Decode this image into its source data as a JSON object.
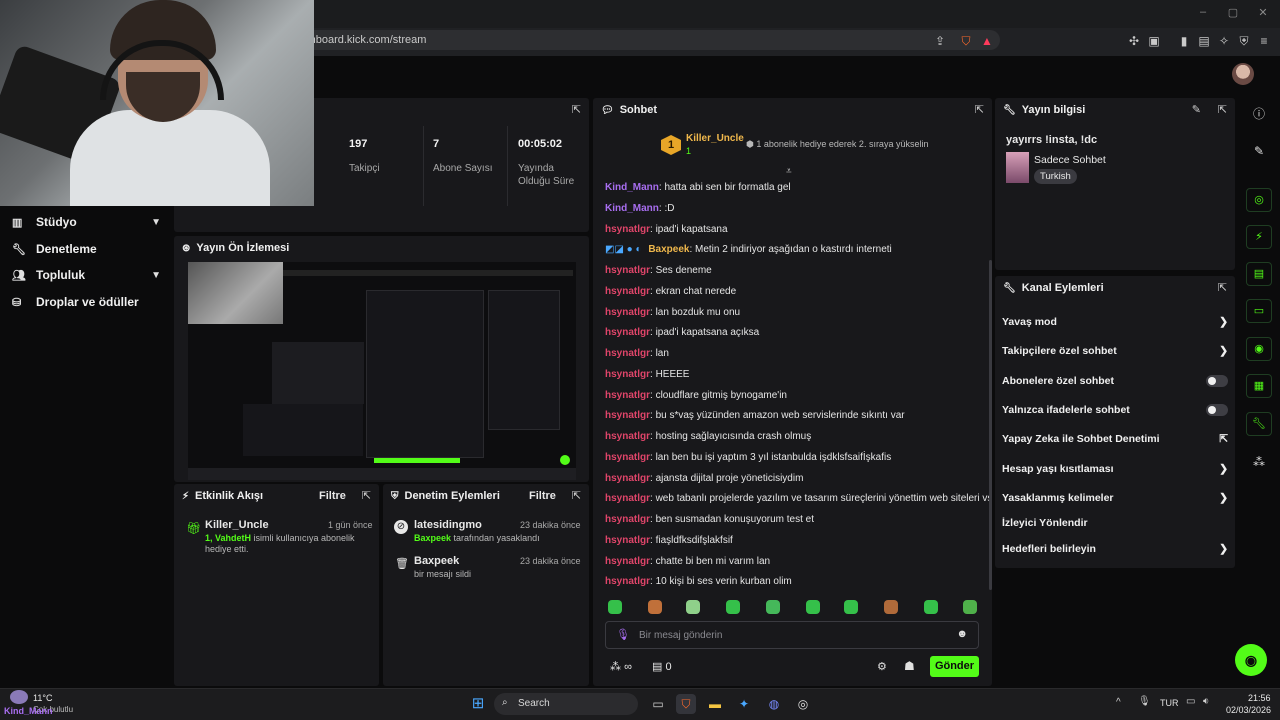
{
  "browser": {
    "url": "ashboard.kick.com/stream"
  },
  "sidebar": {
    "items": [
      {
        "label": "Stüdyo",
        "icon": "studio-icon",
        "expandable": true
      },
      {
        "label": "Denetleme",
        "icon": "wrench-icon",
        "expandable": false
      },
      {
        "label": "Topluluk",
        "icon": "community-icon",
        "expandable": true
      },
      {
        "label": "Droplar ve ödüller",
        "icon": "drops-icon",
        "expandable": false
      }
    ]
  },
  "stats": {
    "followers": {
      "value": "197",
      "label": "Takipçi"
    },
    "subs": {
      "value": "7",
      "label": "Abone Sayısı"
    },
    "uptime": {
      "value": "00:05:02",
      "label_line1": "Yayında",
      "label_line2": "Olduğu Süre"
    }
  },
  "preview": {
    "title": "Yayın Ön İzlemesi"
  },
  "activity": {
    "title": "Etkinlik Akışı",
    "filter": "Filtre",
    "items": [
      {
        "user": "Killer_Uncle",
        "time": "1 gün önce",
        "prefix": "1, VahdetH",
        "text": " isimli kullanıcıya abonelik hediye etti."
      }
    ]
  },
  "moderation": {
    "title": "Denetim Eylemleri",
    "filter": "Filtre",
    "items": [
      {
        "user": "latesidingmo",
        "time": "23 dakika önce",
        "actor": "Baxpeek",
        "text": " tarafından yasaklandı"
      },
      {
        "user": "Baxpeek",
        "time": "23 dakika önce",
        "actor": "",
        "text": "bir mesajı sildi"
      }
    ]
  },
  "chat": {
    "title": "Sohbet",
    "pinned": {
      "user": "Killer_Uncle",
      "rank": "1",
      "count": "1",
      "note": "1 abonelik hediye ederek 2. sıraya yükselin"
    },
    "messages": [
      {
        "user": "Kind_Mann",
        "color": "purple",
        "text": ": hatta abi sen bir formatla gel"
      },
      {
        "user": "Kind_Mann",
        "color": "purple",
        "text": ": :D"
      },
      {
        "user": "hsynatlgr",
        "color": "pink",
        "text": ": ipad'i kapatsana"
      },
      {
        "user": "Baxpeek",
        "color": "gold",
        "text": ": Metin 2 indiriyor aşağıdan o kastırdı interneti"
      },
      {
        "user": "hsynatlgr",
        "color": "pink",
        "text": ": Ses deneme"
      },
      {
        "user": "hsynatlgr",
        "color": "pink",
        "text": ": ekran chat nerede"
      },
      {
        "user": "hsynatlgr",
        "color": "pink",
        "text": ": lan bozduk mu onu"
      },
      {
        "user": "hsynatlgr",
        "color": "pink",
        "text": ": ipad'i kapatsana açıksa"
      },
      {
        "user": "hsynatlgr",
        "color": "pink",
        "text": ": lan"
      },
      {
        "user": "hsynatlgr",
        "color": "pink",
        "text": ": HEEEE"
      },
      {
        "user": "hsynatlgr",
        "color": "pink",
        "text": ": cloudflare gitmiş bynogame'in"
      },
      {
        "user": "hsynatlgr",
        "color": "pink",
        "text": ": bu s*vaş yüzünden amazon web servislerinde sıkıntı var"
      },
      {
        "user": "hsynatlgr",
        "color": "pink",
        "text": ": hosting sağlayıcısında crash olmuş"
      },
      {
        "user": "hsynatlgr",
        "color": "pink",
        "text": ": lan ben bu işi yaptım 3 yıl istanbulda işdklsfsaifİşkafis"
      },
      {
        "user": "hsynatlgr",
        "color": "pink",
        "text": ": ajansta dijital proje yöneticisiydim"
      },
      {
        "user": "hsynatlgr",
        "color": "pink",
        "text": ": web tabanlı projelerde yazılım ve tasarım süreçlerini yönettim web siteleri vs"
      },
      {
        "user": "hsynatlgr",
        "color": "pink",
        "text": ": ben susmadan konuşuyorum test et"
      },
      {
        "user": "hsynatlgr",
        "color": "pink",
        "text": ": fiaşldfksdifşlakfsif"
      },
      {
        "user": "hsynatlgr",
        "color": "pink",
        "text": ": chatte bi ben mi varım lan"
      },
      {
        "user": "hsynatlgr",
        "color": "pink",
        "text": ": 10 kişi bi ses verin kurban olim"
      }
    ],
    "input_placeholder": "Bir mesaj gönderin",
    "points": "∞",
    "gifts": "0",
    "send_label": "Gönder"
  },
  "stream_info": {
    "title": "Yayın bilgisi",
    "stream_title": "yayırrs !insta, !dc",
    "category": "Sadece Sohbet",
    "language": "Turkish"
  },
  "channel_actions": {
    "title": "Kanal Eylemleri",
    "items": [
      {
        "label": "Yavaş mod",
        "type": "chevron"
      },
      {
        "label": "Takipçilere özel sohbet",
        "type": "chevron"
      },
      {
        "label": "Abonelere özel sohbet",
        "type": "toggle"
      },
      {
        "label": "Yalnızca ifadelerle sohbet",
        "type": "toggle"
      },
      {
        "label": "Yapay Zeka ile Sohbet Denetimi",
        "type": "external"
      },
      {
        "label": "Hesap yaşı kısıtlaması",
        "type": "chevron"
      },
      {
        "label": "Yasaklanmış kelimeler",
        "type": "chevron"
      },
      {
        "label": "İzleyici Yönlendir",
        "type": "none"
      },
      {
        "label": "Hedefleri belirleyin",
        "type": "chevron"
      }
    ]
  },
  "taskbar": {
    "weather_temp": "11°C",
    "weather_desc": "Çok bulutlu",
    "weather_overlay": "Kind_Mann",
    "search": "Search",
    "lang": "TUR",
    "time": "21:56",
    "date": "02/03/2026"
  },
  "colors": {
    "accent": "#53fc18",
    "panel": "#18181b",
    "background": "#0b0b0c"
  }
}
